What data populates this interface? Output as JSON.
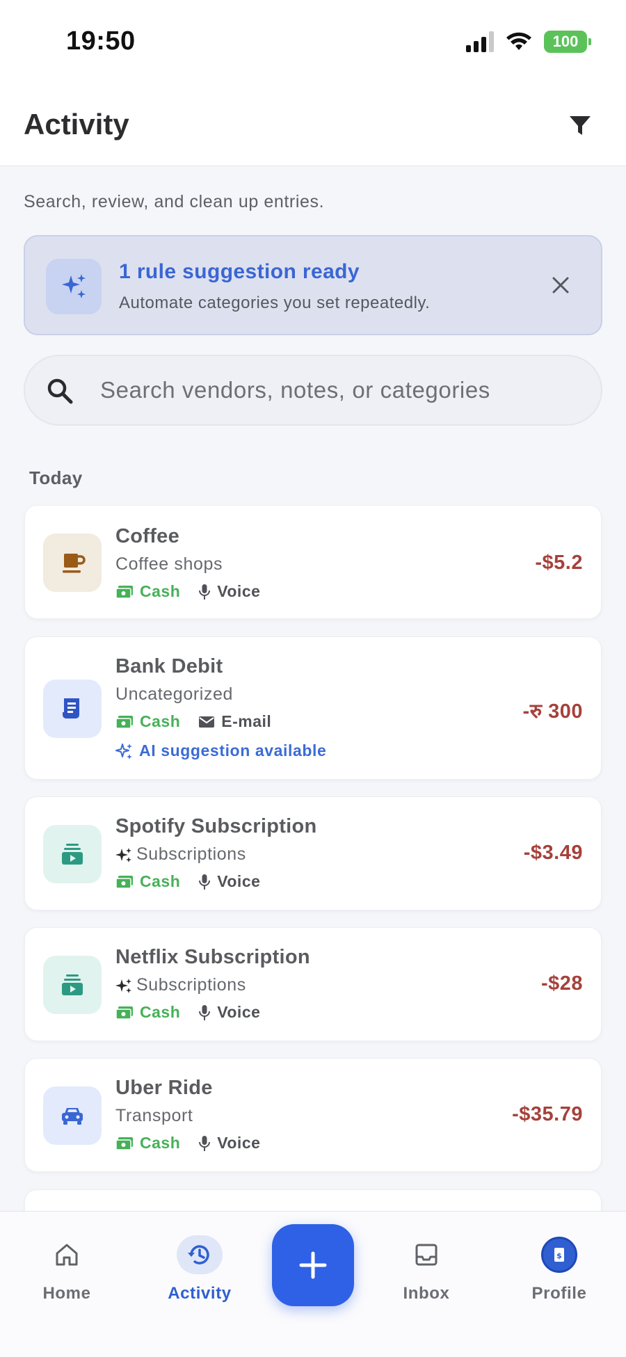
{
  "status_bar": {
    "time": "19:50",
    "battery": "100"
  },
  "header": {
    "title": "Activity"
  },
  "subtitle": "Search, review, and clean up entries.",
  "banner": {
    "title": "1 rule suggestion ready",
    "text": "Automate categories you set repeatedly."
  },
  "search": {
    "placeholder": "Search vendors, notes, or categories",
    "value": ""
  },
  "section": {
    "label": "Today"
  },
  "transactions": [
    {
      "name": "Coffee",
      "category": "Coffee shops",
      "payment": "Cash",
      "source": "Voice",
      "amount": "-$5.2",
      "icon": "coffee-icon"
    },
    {
      "name": "Bank Debit",
      "category": "Uncategorized",
      "payment": "Cash",
      "source": "E-mail",
      "amount": "-रु 300",
      "icon": "receipt-icon",
      "ai_text": "AI suggestion available"
    },
    {
      "name": "Spotify Subscription",
      "category": "Subscriptions",
      "payment": "Cash",
      "source": "Voice",
      "amount": "-$3.49",
      "icon": "subscriptions-icon"
    },
    {
      "name": "Netflix Subscription",
      "category": "Subscriptions",
      "payment": "Cash",
      "source": "Voice",
      "amount": "-$28",
      "icon": "subscriptions-icon"
    },
    {
      "name": "Uber Ride",
      "category": "Transport",
      "payment": "Cash",
      "source": "Voice",
      "amount": "-$35.79",
      "icon": "car-icon"
    }
  ],
  "nav": {
    "home": "Home",
    "activity": "Activity",
    "inbox": "Inbox",
    "profile": "Profile"
  },
  "colors": {
    "accent": "#2f61e6",
    "cash": "#46b158",
    "amount": "#a6413b",
    "ai": "#3b6bd6"
  }
}
